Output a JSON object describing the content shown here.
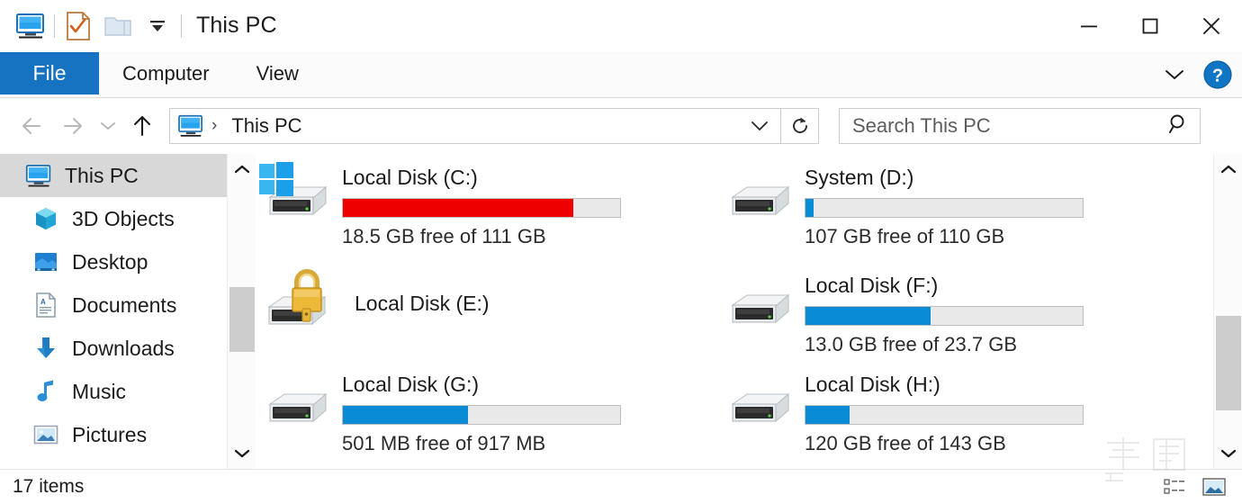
{
  "window": {
    "title": "This PC",
    "quick_access": [
      {
        "name": "this-pc-icon",
        "label": "This PC"
      },
      {
        "name": "properties-icon",
        "label": "Properties"
      },
      {
        "name": "new-folder-icon",
        "label": "New folder"
      },
      {
        "name": "customize-quick-access-icon",
        "label": "Customize Quick Access Toolbar"
      }
    ],
    "controls": {
      "minimize": "Minimize",
      "maximize": "Maximize",
      "close": "Close"
    }
  },
  "ribbon": {
    "file_tab": "File",
    "tabs": [
      "Computer",
      "View"
    ],
    "expand_label": "Expand the Ribbon",
    "help_label": "Help",
    "accent_color": "#1673c1"
  },
  "navigation": {
    "back_label": "Back",
    "forward_label": "Forward",
    "recent_label": "Recent locations",
    "up_label": "Up",
    "breadcrumb": {
      "root_icon": "this-pc-icon",
      "separator": "›",
      "path": "This PC"
    },
    "address_dropdown_label": "Previous locations",
    "refresh_label": "Refresh"
  },
  "search": {
    "placeholder": "Search This PC",
    "value": ""
  },
  "sidebar": {
    "items": [
      {
        "label": "This PC",
        "icon": "this-pc-icon",
        "selected": true
      },
      {
        "label": "3D Objects",
        "icon": "3d-objects-icon",
        "selected": false
      },
      {
        "label": "Desktop",
        "icon": "desktop-icon",
        "selected": false
      },
      {
        "label": "Documents",
        "icon": "documents-icon",
        "selected": false
      },
      {
        "label": "Downloads",
        "icon": "downloads-icon",
        "selected": false
      },
      {
        "label": "Music",
        "icon": "music-icon",
        "selected": false
      },
      {
        "label": "Pictures",
        "icon": "pictures-icon",
        "selected": false
      }
    ]
  },
  "drives": [
    {
      "name": "Local Disk (C:)",
      "free_text": "18.5 GB free of 111 GB",
      "used_percent": 83,
      "bar_color": "#ee0000",
      "icon": "hard-drive-icon",
      "overlay": "windows-logo-overlay",
      "locked": false
    },
    {
      "name": "System (D:)",
      "free_text": "107 GB free of 110 GB",
      "used_percent": 3,
      "bar_color": "#0a8bd6",
      "icon": "hard-drive-icon",
      "overlay": "",
      "locked": false
    },
    {
      "name": "Local Disk (E:)",
      "free_text": "",
      "used_percent": 0,
      "bar_color": "",
      "icon": "hard-drive-icon",
      "overlay": "lock-icon",
      "locked": true
    },
    {
      "name": "Local Disk (F:)",
      "free_text": "13.0 GB free of 23.7 GB",
      "used_percent": 45,
      "bar_color": "#0a8bd6",
      "icon": "hard-drive-icon",
      "overlay": "",
      "locked": false
    },
    {
      "name": "Local Disk (G:)",
      "free_text": "501 MB free of 917 MB",
      "used_percent": 45,
      "bar_color": "#0a8bd6",
      "icon": "hard-drive-icon",
      "overlay": "",
      "locked": false
    },
    {
      "name": "Local Disk (H:)",
      "free_text": "120 GB free of 143 GB",
      "used_percent": 16,
      "bar_color": "#0a8bd6",
      "icon": "hard-drive-icon",
      "overlay": "",
      "locked": false
    }
  ],
  "status": {
    "items_text": "17 items",
    "details_view_label": "Details view",
    "large_icons_view_label": "Large icons view"
  }
}
